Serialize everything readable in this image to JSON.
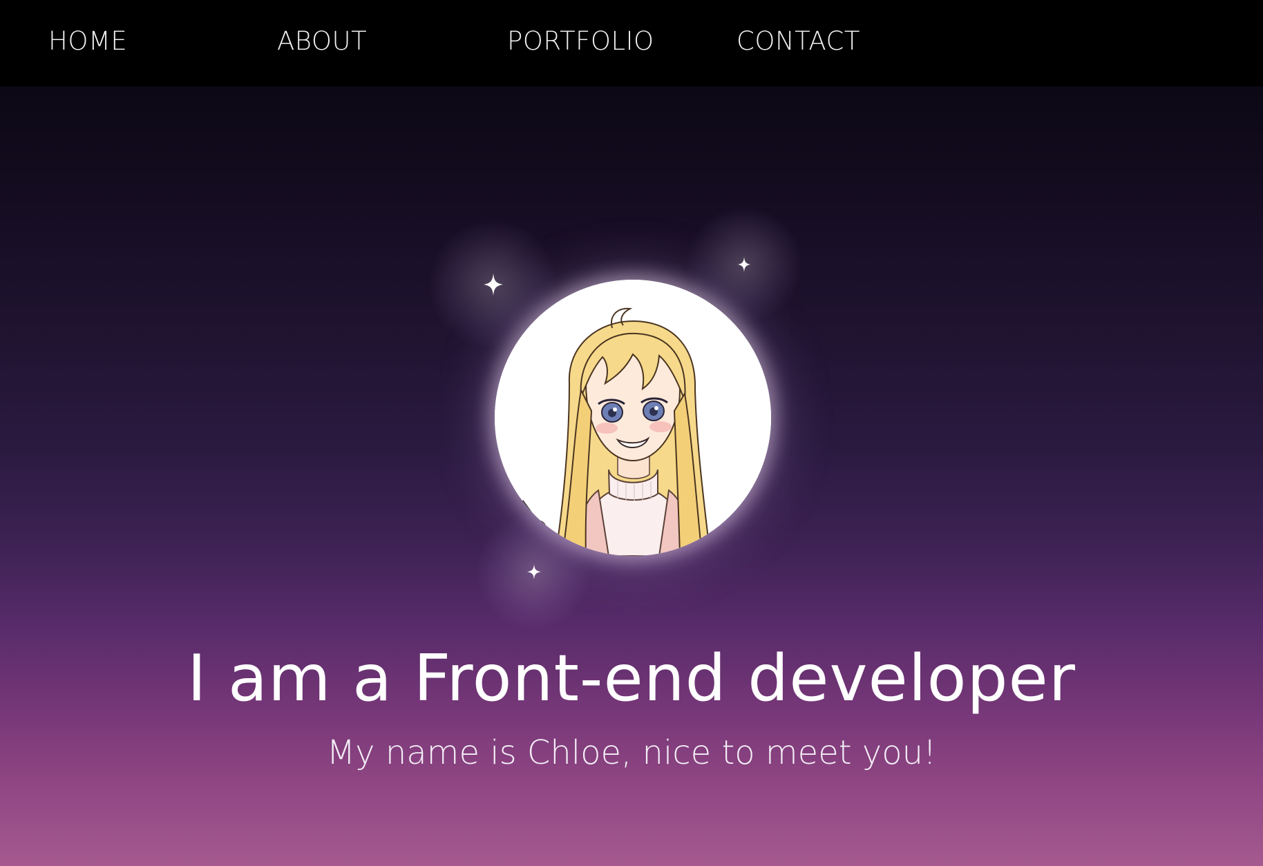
{
  "nav": {
    "items": [
      {
        "label": "HOME"
      },
      {
        "label": "ABOUT"
      },
      {
        "label": "PORTFOLIO"
      },
      {
        "label": "CONTACT"
      }
    ]
  },
  "hero": {
    "headline": "I am a Front-end developer",
    "subline": "My name is Chloe, nice to meet you!",
    "avatar_icon": "avatar-illustration",
    "sparkle_icon": "sparkle-icon"
  },
  "colors": {
    "nav_bg": "#000000",
    "gradient_top": "#07050d",
    "gradient_bottom": "#a5598f",
    "text": "#ffffff"
  }
}
